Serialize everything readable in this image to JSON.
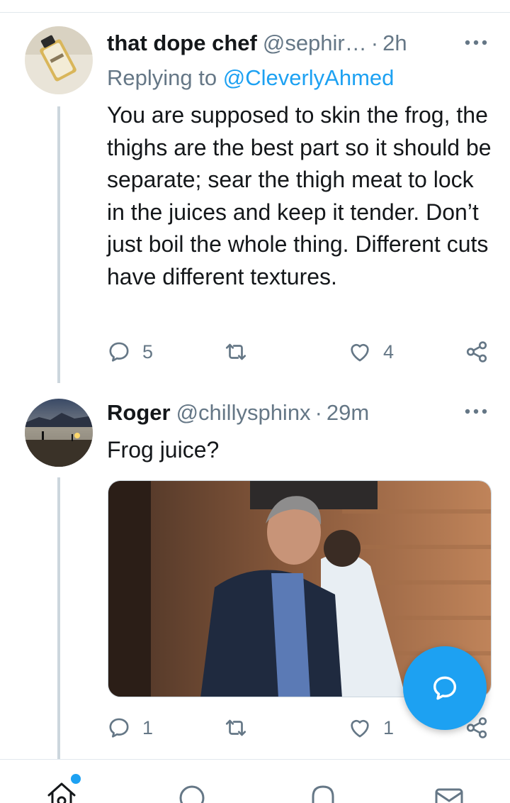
{
  "tweets": [
    {
      "name": "that dope chef",
      "handle": "@sephir…",
      "separator": "·",
      "time": "2h",
      "more_icon": "more-icon",
      "replying_prefix": "Replying to",
      "replying_mention": "@CleverlyAhmed",
      "text": "You are supposed to skin the frog, the thighs are the best part so it should be separate; sear the thigh meat to lock in the juices and keep it tender. Don’t just boil the whole thing. Different cuts have different textures.",
      "reply_count": "5",
      "retweet_count": "",
      "like_count": "4"
    },
    {
      "name": "Roger",
      "handle": "@chillysphinx",
      "separator": "·",
      "time": "29m",
      "more_icon": "more-icon",
      "text": "Frog juice?",
      "reply_count": "1",
      "retweet_count": "",
      "like_count": "1"
    }
  ],
  "colors": {
    "accent": "#1da1f2",
    "secondary_text": "#657786",
    "primary_text": "#14171a",
    "divider": "#e1e8ed"
  },
  "fab": {
    "icon": "compose-reply-icon"
  },
  "bottom_nav": [
    "home-icon",
    "search-icon",
    "notifications-icon",
    "messages-icon"
  ]
}
